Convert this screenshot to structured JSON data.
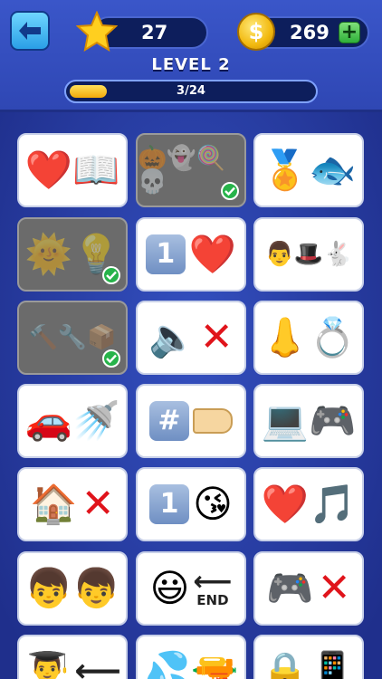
{
  "header": {
    "stars": "27",
    "coins": "269",
    "coin_symbol": "$",
    "plus": "+",
    "level_title": "LEVEL 2",
    "progress_text": "3/24",
    "progress_fraction": 0.125
  },
  "tiles": [
    {
      "emojis": "❤️📖"
    },
    {
      "emojis": "🎃👻🍭💀"
    },
    {
      "emojis": "🏅🐟"
    },
    {
      "emojis": "🌞💡"
    },
    {
      "num": "1",
      "emojis": "❤️"
    },
    {
      "emojis": "👨🎩🐇"
    },
    {
      "emojis": "🔨🔧📦"
    },
    {
      "emojis": "🔈",
      "x": "✕"
    },
    {
      "emojis": "👃💍"
    },
    {
      "emojis": "🚗🚿"
    },
    {
      "num": "#"
    },
    {
      "emojis": "💻🎮"
    },
    {
      "emojis": "🏠",
      "x": "✕"
    },
    {
      "num": "1",
      "emojis": "😘"
    },
    {
      "emojis": "❤️🎵"
    },
    {
      "emojis": "👦👦"
    },
    {
      "emojis": "😃",
      "end_label": "END",
      "arrow": "⟵"
    },
    {
      "emojis": "🎮",
      "x": "✕"
    },
    {
      "emojis": "👨‍🎓",
      "arrow": "⟵"
    },
    {
      "emojis": "💦🔫"
    },
    {
      "emojis": "🔒📱"
    }
  ],
  "icons": {
    "back": "left-arrow-icon",
    "star": "star-icon",
    "coin": "coin-icon",
    "check": "check-icon"
  }
}
